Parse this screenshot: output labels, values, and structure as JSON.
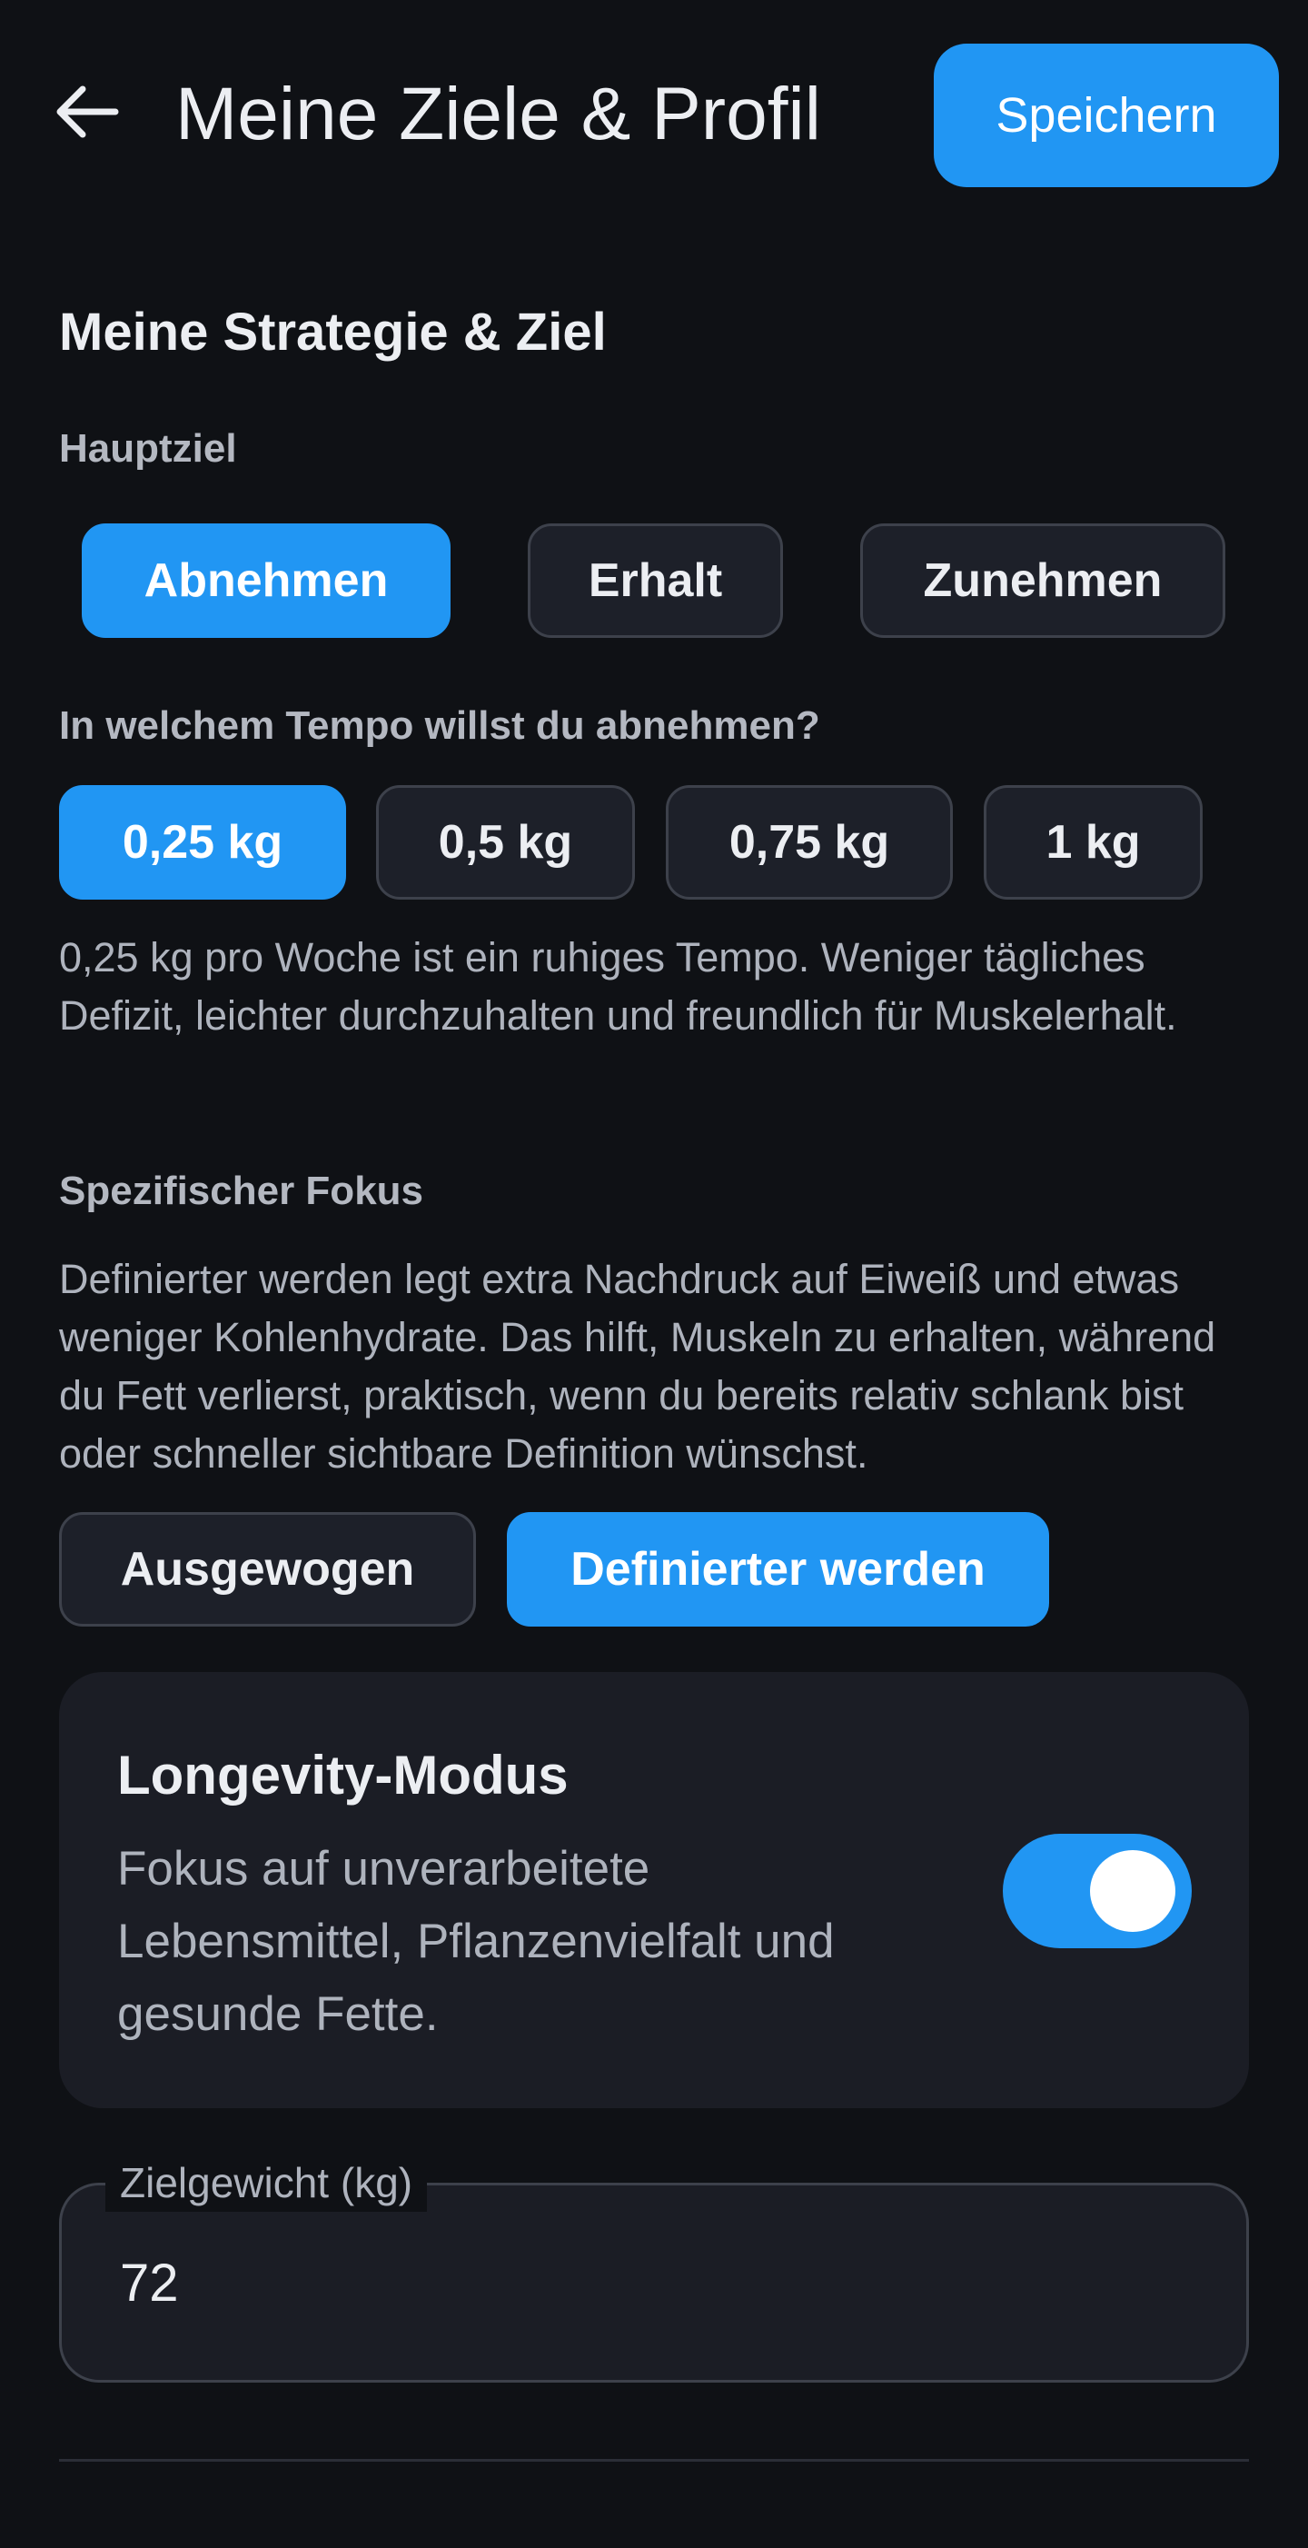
{
  "header": {
    "back_icon": "arrow-left-icon",
    "title": "Meine Ziele & Profil",
    "save_label": "Speichern"
  },
  "strategy": {
    "section_title": "Meine Strategie & Ziel",
    "main_goal_label": "Hauptziel",
    "goals": [
      {
        "label": "Abnehmen",
        "selected": true
      },
      {
        "label": "Erhalt",
        "selected": false
      },
      {
        "label": "Zunehmen",
        "selected": false
      }
    ],
    "tempo_question": "In welchem Tempo willst du abnehmen?",
    "tempos": [
      {
        "label": "0,25 kg",
        "selected": true
      },
      {
        "label": "0,5 kg",
        "selected": false
      },
      {
        "label": "0,75 kg",
        "selected": false
      },
      {
        "label": "1 kg",
        "selected": false
      }
    ],
    "tempo_description": "0,25 kg pro Woche ist ein ruhiges Tempo. Weniger tägliches Defizit, leichter durchzuhalten und freundlich für Muskelerhalt.",
    "focus_label": "Spezifischer Fokus",
    "focus_description": "Definierter werden legt extra Nachdruck auf Eiweiß und etwas weniger Kohlenhydrate. Das hilft, Muskeln zu erhalten, während du Fett verlierst, praktisch, wenn du bereits relativ schlank bist oder schneller sichtbare Definition wünschst.",
    "focus_options": [
      {
        "label": "Ausgewogen",
        "selected": false
      },
      {
        "label": "Definierter werden",
        "selected": true
      }
    ]
  },
  "longevity": {
    "title": "Longevity-Modus",
    "description": "Fokus auf unverarbeitete Lebensmittel, Pflanzenvielfalt und gesunde Fette.",
    "enabled": true
  },
  "target_weight": {
    "label": "Zielgewicht (kg)",
    "value": "72"
  },
  "colors": {
    "accent": "#2196f3",
    "background": "#0f1115",
    "card": "#1b1d25",
    "chip": "#1d2029"
  }
}
